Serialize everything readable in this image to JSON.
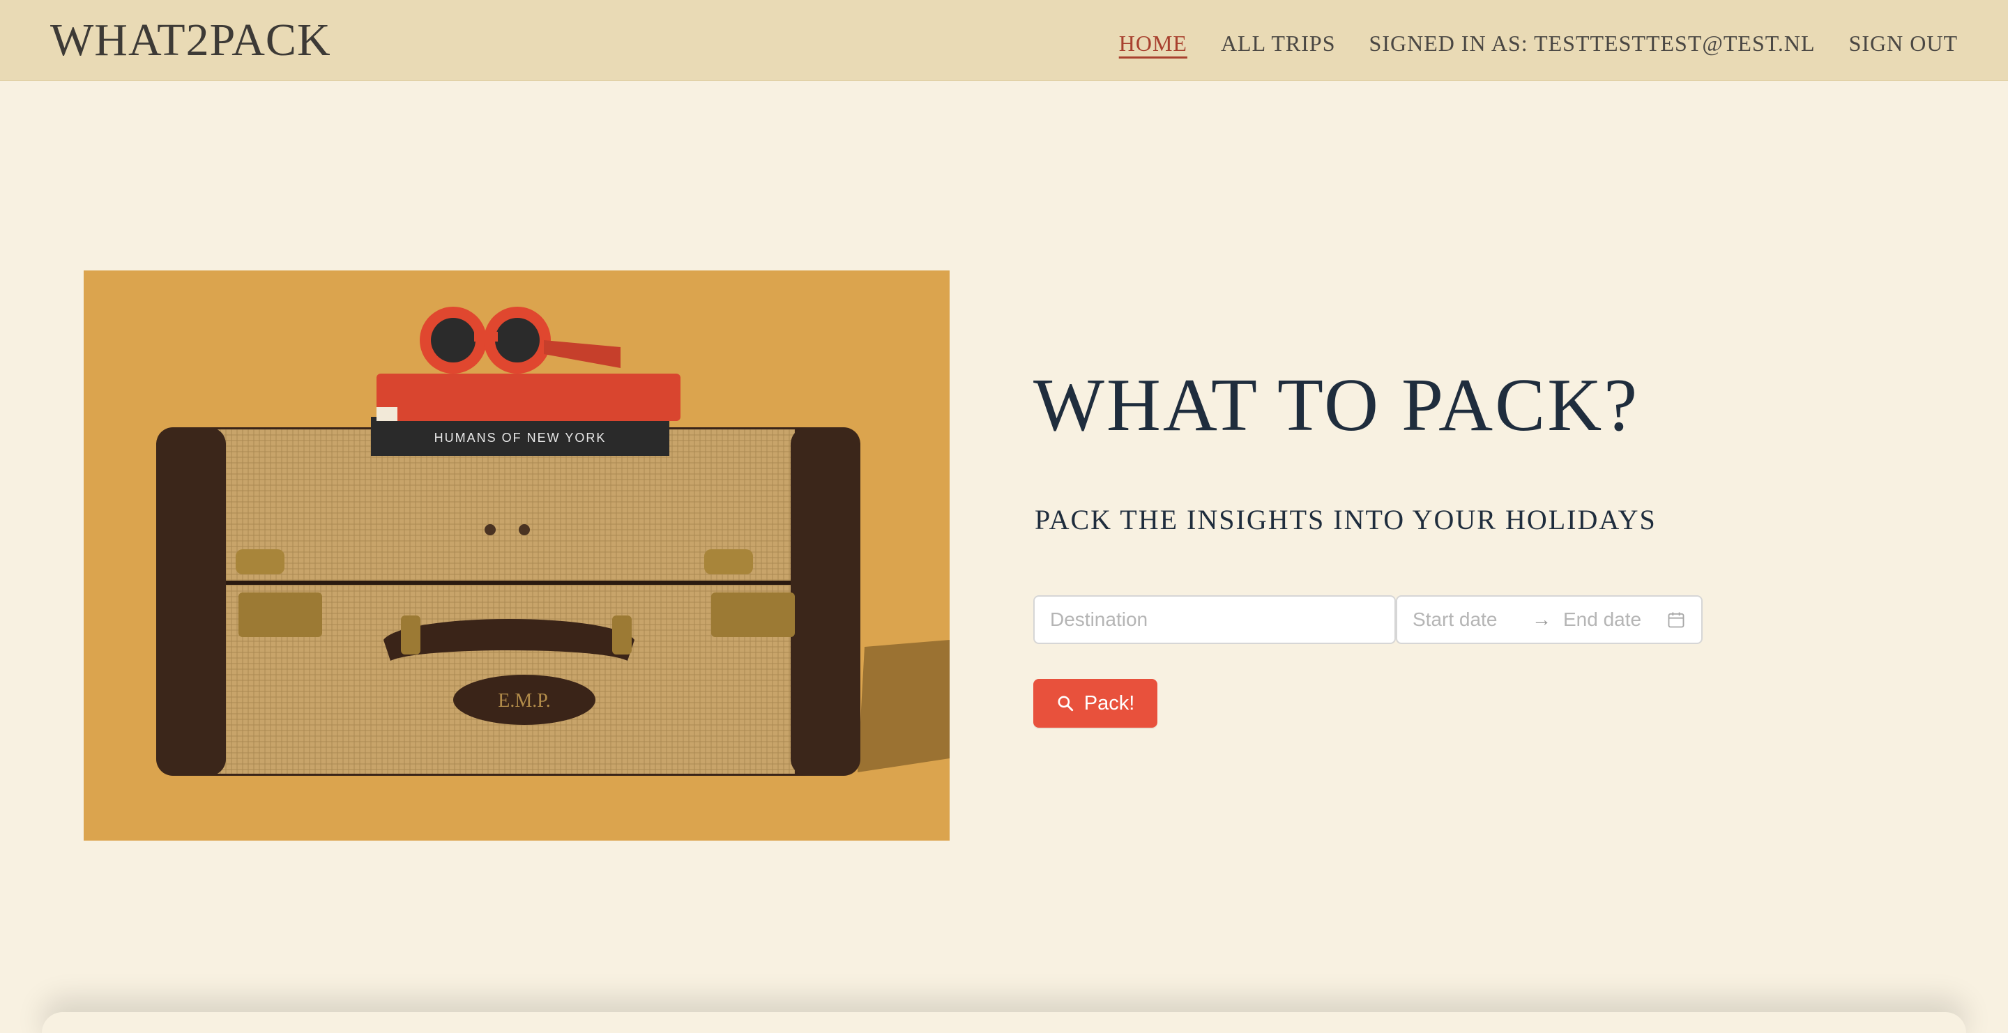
{
  "app": {
    "brand": "WHAT2PACK"
  },
  "nav": {
    "home": "HOME",
    "all_trips": "ALL TRIPS",
    "signed_in": "SIGNED IN AS: TESTTESTTEST@TEST.NL",
    "sign_out": "SIGN OUT"
  },
  "hero": {
    "title": "WHAT TO PACK?",
    "subtitle": "PACK THE INSIGHTS INTO YOUR HOLIDAYS",
    "image_subject": "vintage suitcase with books and red sunglasses",
    "book_title": "HUMANS OF NEW YORK",
    "tag_text": "E.M.P."
  },
  "search": {
    "destination_placeholder": "Destination",
    "start_placeholder": "Start date",
    "arrow": "→",
    "end_placeholder": "End date",
    "calendar_icon": "calendar-icon",
    "button_label": "Pack!",
    "button_icon": "search-icon"
  },
  "colors": {
    "background": "#f8f1e1",
    "topbar": "#e9dab5",
    "accent": "#e8513c",
    "title": "#1f2d3d",
    "active_nav": "#a8412f"
  }
}
